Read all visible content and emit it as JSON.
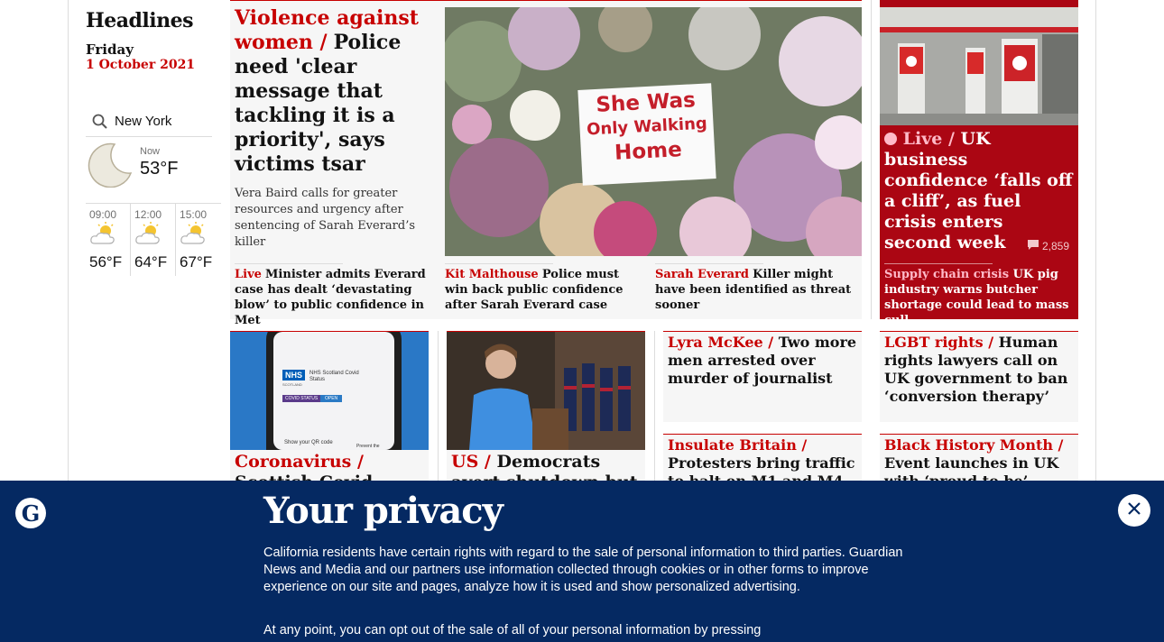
{
  "section": {
    "title": "Headlines",
    "day": "Friday",
    "date": "1 October 2021"
  },
  "weather": {
    "location": "New York",
    "now_label": "Now",
    "now_temp": "53°F",
    "forecast": [
      {
        "time": "09:00",
        "temp": "56°F"
      },
      {
        "time": "12:00",
        "temp": "64°F"
      },
      {
        "time": "15:00",
        "temp": "67°F"
      }
    ]
  },
  "lead": {
    "kicker": "Violence against women /",
    "headline": "Police need 'clear message that tackling it is a priority', says victims tsar",
    "standfirst": "Vera Baird calls for greater resources and urgency after sentencing of Sarah Everard’s killer",
    "image_sign": [
      "She Was",
      "Only Walking",
      "Home"
    ],
    "subs": [
      {
        "kicker": "Live",
        "text": "Minister admits Everard case has dealt ‘devastating blow’ to public confidence in Met"
      },
      {
        "kicker": "Kit Malthouse",
        "text": "Police must win back public confidence after Sarah Everard case"
      },
      {
        "kicker": "Sarah Everard",
        "text": "Killer might have been identified as threat sooner"
      }
    ]
  },
  "live": {
    "label": "Live /",
    "headline": "UK business confidence ‘falls off a cliff’, as fuel crisis enters second week",
    "comments": "2,859",
    "sub_kicker": "Supply chain crisis",
    "sub_text": "UK pig industry warns butcher shortage could lead to mass cull"
  },
  "row2": [
    {
      "kicker": "Coronavirus /",
      "headline": "Scottish Covid vaccine passport"
    },
    {
      "kicker": "US /",
      "headline": "Democrats avert shutdown but Biden's"
    },
    {
      "kicker": "Lyra McKee /",
      "headline": "Two more men arrested over murder of journalist"
    },
    {
      "kicker": "LGBT rights /",
      "headline": "Human rights lawyers call on UK government to ban ‘conversion therapy’"
    },
    {
      "kicker": "Insulate Britain  /",
      "headline": "Protesters bring traffic to halt on M1 and M4"
    },
    {
      "kicker": "Black History Month /",
      "headline": "Event launches in UK with ‘proud to be’ campaign"
    }
  ],
  "phone_screen": {
    "brand": "NHS",
    "sub": "SCOTLAND",
    "title": "NHS Scotland Covid Status",
    "status": "COVID STATUS",
    "open": "OPEN",
    "qr": "Show your QR code",
    "prevent": "Prevent the"
  },
  "privacy": {
    "title": "Your privacy",
    "body": "California residents have certain rights with regard to the sale of personal information to third parties. Guardian News and Media and our partners use information collected through cookies or in other forms to improve experience on our site and pages, analyze how it is used and show personalized advertising.",
    "body2": "At any point, you can opt out of the sale of all of your personal information by pressing"
  },
  "colors": {
    "accent": "#c70000",
    "live_bg": "#ab0613",
    "banner_bg": "#052962"
  }
}
